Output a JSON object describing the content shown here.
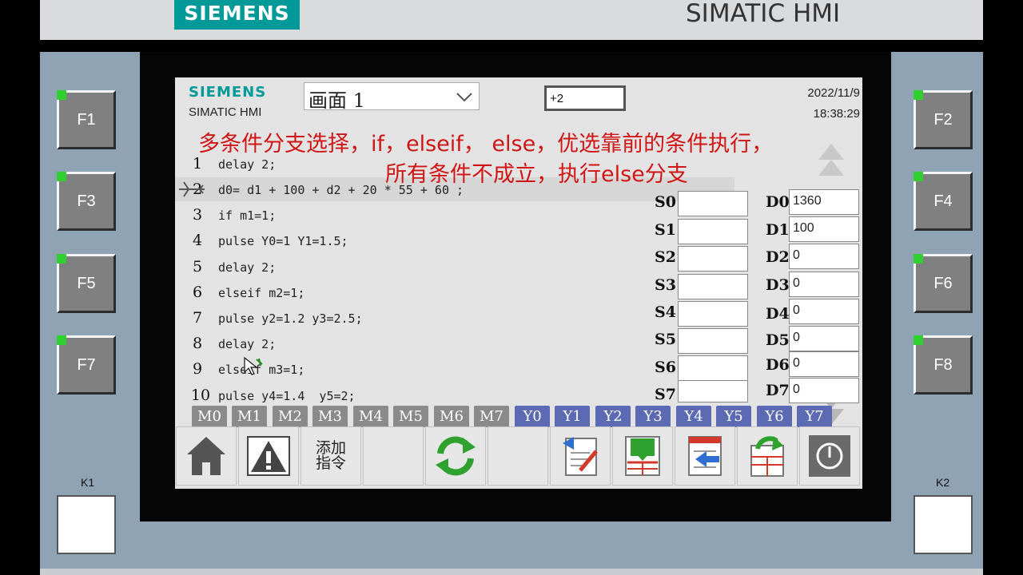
{
  "device": {
    "brand": "SIEMENS",
    "product": "SIMATIC HMI"
  },
  "function_keys": [
    {
      "label": "F1"
    },
    {
      "label": "F2"
    },
    {
      "label": "F3"
    },
    {
      "label": "F4"
    },
    {
      "label": "F5"
    },
    {
      "label": "F6"
    },
    {
      "label": "F7"
    },
    {
      "label": "F8"
    }
  ],
  "k_keys": [
    {
      "label": "K1"
    },
    {
      "label": "K2"
    }
  ],
  "header": {
    "logo": "SIEMENS",
    "logo_sub": "SIMATIC HMI",
    "screen_select": "画面 1",
    "value_field": "+2",
    "date": "2022/11/9",
    "time": "18:38:29"
  },
  "annotation": {
    "line1": "多条件分支选择，if，elseif， else，优选靠前的条件执行，",
    "line2": "所有条件不成立，执行else分支"
  },
  "code_lines": [
    {
      "num": "1",
      "text": "delay 2;"
    },
    {
      "num": "2",
      "text": "d0= d1 + 100 + d2 + 20 * 55 + 60 ;"
    },
    {
      "num": "3",
      "text": "if m1=1;"
    },
    {
      "num": "4",
      "text": "pulse Y0=1 Y1=1.5;"
    },
    {
      "num": "5",
      "text": "delay 2;"
    },
    {
      "num": "6",
      "text": "elseif m2=1;"
    },
    {
      "num": "7",
      "text": "pulse y2=1.2 y3=2.5;"
    },
    {
      "num": "8",
      "text": "delay 2;"
    },
    {
      "num": "9",
      "text": "elseif m3=1;"
    },
    {
      "num": "10",
      "text": "pulse y4=1.4  y5=2;"
    }
  ],
  "s_registers": [
    {
      "label": "S0",
      "value": ""
    },
    {
      "label": "S1",
      "value": ""
    },
    {
      "label": "S2",
      "value": ""
    },
    {
      "label": "S3",
      "value": ""
    },
    {
      "label": "S4",
      "value": ""
    },
    {
      "label": "S5",
      "value": ""
    },
    {
      "label": "S6",
      "value": ""
    },
    {
      "label": "S7",
      "value": ""
    }
  ],
  "d_registers": [
    {
      "label": "D0",
      "value": "1360"
    },
    {
      "label": "D1",
      "value": "100"
    },
    {
      "label": "D2",
      "value": "0"
    },
    {
      "label": "D3",
      "value": "0"
    },
    {
      "label": "D4",
      "value": "0"
    },
    {
      "label": "D5",
      "value": "0"
    },
    {
      "label": "D6",
      "value": "0"
    },
    {
      "label": "D7",
      "value": "0"
    }
  ],
  "bits": [
    {
      "label": "M0"
    },
    {
      "label": "M1"
    },
    {
      "label": "M2"
    },
    {
      "label": "M3"
    },
    {
      "label": "M4"
    },
    {
      "label": "M5"
    },
    {
      "label": "M6"
    },
    {
      "label": "M7"
    },
    {
      "label": "Y0"
    },
    {
      "label": "Y1"
    },
    {
      "label": "Y2"
    },
    {
      "label": "Y3"
    },
    {
      "label": "Y4"
    },
    {
      "label": "Y5"
    },
    {
      "label": "Y6"
    },
    {
      "label": "Y7"
    }
  ],
  "toolbar": {
    "add_instruction": "添加\n指令",
    "icons": [
      "home-icon",
      "alarm-warning-icon",
      "",
      "",
      "refresh-icon",
      "",
      "edit-document-icon",
      "download-table-icon",
      "import-table-icon",
      "export-table-icon",
      "power-icon"
    ]
  },
  "colors": {
    "siemens_teal": "#009999",
    "annotation_red": "#d11515",
    "bit_m": "#8a8a8a",
    "bit_y": "#5b6ab3",
    "led_green": "#2ed12e"
  }
}
